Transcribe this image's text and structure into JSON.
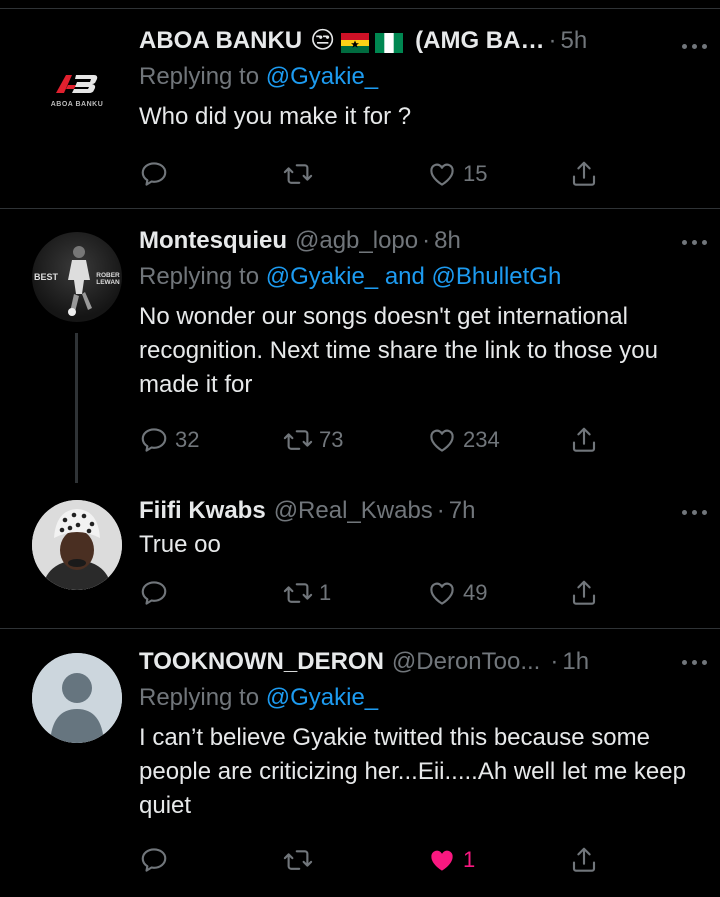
{
  "tweets": [
    {
      "name": "ABOA BANKU",
      "emoji": "😒",
      "name_suffix": "(AMG BA…",
      "handle": "",
      "time": "5h",
      "replying_prefix": "Replying to",
      "mentions": [
        "@Gyakie_"
      ],
      "text": "Who did you make it for ?",
      "avatar_text": "ABOA BANKU",
      "reply_count": "",
      "retweet_count": "",
      "like_count": "15",
      "liked": false
    },
    {
      "name": "Montesquieu",
      "handle": "@agb_lopo",
      "time": "8h",
      "replying_prefix": "Replying to",
      "mentions": [
        "@Gyakie_",
        "@BhulletGh"
      ],
      "mention_joiner": "and",
      "text": "No wonder our songs doesn't get international recognition. Next time share the link to those you made it for",
      "avatar_text_left": "BEST",
      "avatar_text_right": "ROBER LEWAN",
      "reply_count": "32",
      "retweet_count": "73",
      "like_count": "234",
      "liked": false
    },
    {
      "name": "Fiifi Kwabs",
      "handle": "@Real_Kwabs",
      "time": "7h",
      "text": "True oo",
      "reply_count": "",
      "retweet_count": "1",
      "like_count": "49",
      "liked": false
    },
    {
      "name": "TOOKNOWN_DERON",
      "handle": "@DeronToo...",
      "time": "1h",
      "replying_prefix": "Replying to",
      "mentions": [
        "@Gyakie_"
      ],
      "text": "I can’t believe Gyakie twitted this because some people are criticizing her...Eii.....Ah well let me keep quiet",
      "reply_count": "",
      "retweet_count": "",
      "like_count": "1",
      "liked": true
    }
  ],
  "dot_sep": "·",
  "colors": {
    "background": "#000000",
    "text": "#e7e9ea",
    "muted": "#71767b",
    "link": "#1d9bf0",
    "liked": "#f91880",
    "divider": "#2f3336"
  },
  "icons": [
    "reply-icon",
    "retweet-icon",
    "like-icon",
    "share-icon",
    "more-icon"
  ]
}
